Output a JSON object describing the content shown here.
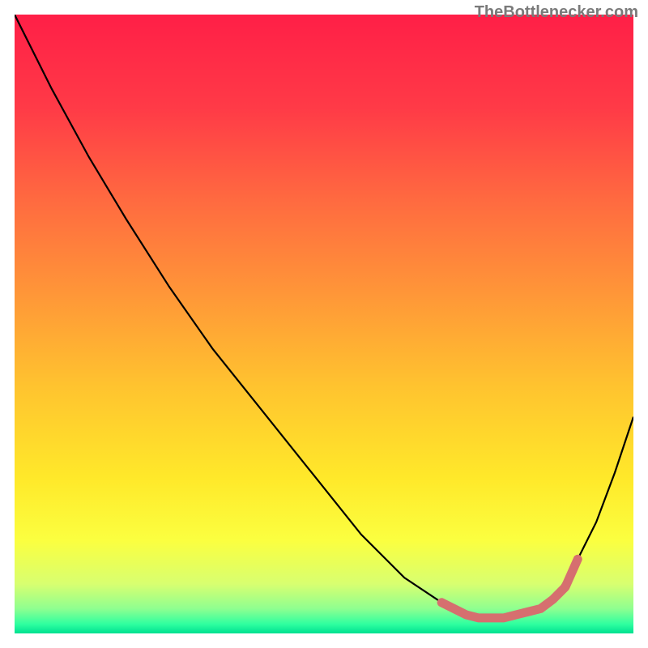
{
  "attribution": "TheBottlenecker.com",
  "chart_data": {
    "type": "line",
    "title": "",
    "xlabel": "",
    "ylabel": "",
    "xlim": [
      0,
      100
    ],
    "ylim": [
      0,
      100
    ],
    "ylim_inverted": true,
    "series": [
      {
        "name": "main-curve",
        "color": "#000000",
        "x": [
          0,
          6,
          12,
          18,
          25,
          32,
          40,
          48,
          56,
          63,
          69,
          73,
          76,
          79,
          82,
          85,
          88,
          91,
          94,
          97,
          100
        ],
        "values": [
          0,
          12,
          23,
          33,
          44,
          54,
          64,
          74,
          84,
          91,
          95,
          97,
          97.5,
          97.5,
          97,
          96,
          93,
          88,
          82,
          74,
          65
        ]
      },
      {
        "name": "highlight-band",
        "color": "#d66f6f",
        "x": [
          69,
          71,
          73,
          75,
          77,
          79,
          81,
          83,
          85,
          87,
          89,
          91
        ],
        "values": [
          95,
          96,
          97,
          97.5,
          97.5,
          97.5,
          97,
          96.5,
          96,
          94.5,
          92.5,
          88
        ]
      }
    ],
    "background_gradient": {
      "type": "vertical",
      "stops": [
        {
          "offset": 0.0,
          "color": "#ff1f47"
        },
        {
          "offset": 0.15,
          "color": "#ff3a47"
        },
        {
          "offset": 0.3,
          "color": "#ff6a40"
        },
        {
          "offset": 0.45,
          "color": "#ff9638"
        },
        {
          "offset": 0.6,
          "color": "#ffc32f"
        },
        {
          "offset": 0.75,
          "color": "#ffe92a"
        },
        {
          "offset": 0.85,
          "color": "#fbff40"
        },
        {
          "offset": 0.92,
          "color": "#d8ff70"
        },
        {
          "offset": 0.96,
          "color": "#8fff90"
        },
        {
          "offset": 0.985,
          "color": "#2fffa0"
        },
        {
          "offset": 1.0,
          "color": "#00e090"
        }
      ]
    }
  }
}
